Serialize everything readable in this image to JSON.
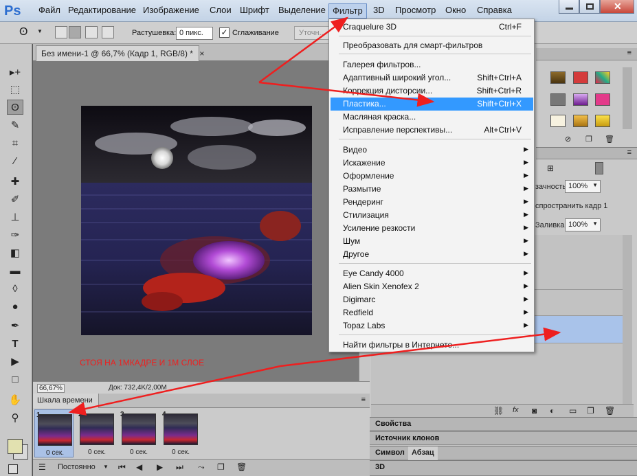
{
  "menubar": {
    "logo": "Ps",
    "items": [
      "Файл",
      "Редактирование",
      "Изображение",
      "Слои",
      "Шрифт",
      "Выделение",
      "Фильтр",
      "3D",
      "Просмотр",
      "Окно",
      "Справка"
    ]
  },
  "options": {
    "feather_label": "Растушевка:",
    "feather_value": "0 пикс.",
    "antialias_label": "Сглаживание",
    "antialias_check": "✓",
    "refine_label": "Уточн..."
  },
  "document": {
    "tab_title": "Без имени-1 @ 66,7% (Кадр 1, RGB/8) *",
    "tab_close": "×",
    "zoom": "66,67%",
    "status": "Док: 732,4K/2,00M"
  },
  "annotation": {
    "text": "СТОЯ НА 1МКАДРЕ И 1М СЛОЕ"
  },
  "timeline": {
    "title": "Шкала времени",
    "loop": "Постоянно",
    "frames": [
      {
        "num": "1",
        "delay": "0 сек."
      },
      {
        "num": "2",
        "delay": "0 сек."
      },
      {
        "num": "3",
        "delay": "0 сек."
      },
      {
        "num": "4",
        "delay": "0 сек."
      }
    ]
  },
  "filter_menu": {
    "last_filter": {
      "label": "Craquelure 3D",
      "shortcut": "Ctrl+F"
    },
    "smart": "Преобразовать для смарт-фильтров",
    "group1": [
      {
        "label": "Галерея фильтров...",
        "shortcut": ""
      },
      {
        "label": "Адаптивный широкий угол...",
        "shortcut": "Shift+Ctrl+A"
      },
      {
        "label": "Коррекция дисторсии...",
        "shortcut": "Shift+Ctrl+R"
      },
      {
        "label": "Пластика...",
        "shortcut": "Shift+Ctrl+X"
      },
      {
        "label": "Масляная краска...",
        "shortcut": ""
      },
      {
        "label": "Исправление перспективы...",
        "shortcut": "Alt+Ctrl+V"
      }
    ],
    "group2": [
      "Видео",
      "Искажение",
      "Оформление",
      "Размытие",
      "Рендеринг",
      "Стилизация",
      "Усиление резкости",
      "Шум",
      "Другое"
    ],
    "group3": [
      "Eye Candy 4000",
      "Alien Skin Xenofex 2",
      "Digimarc",
      "Redfield",
      "Topaz Labs"
    ],
    "online": "Найти фильтры в Интернете..."
  },
  "layers_panel": {
    "opacity_label": "зачность:",
    "opacity_value": "100%",
    "propagate": "спространить кадр 1",
    "fill_label": "Заливка:",
    "fill_value": "100%"
  },
  "right_tabs": {
    "properties": "Свойства",
    "clone_source": "Источник клонов",
    "character": "Символ",
    "paragraph": "Абзац",
    "three_d": "3D"
  },
  "colors": {
    "arrow": "#ee1f1f",
    "highlight": "#3399ff",
    "foreground": "#e2e1b0"
  }
}
